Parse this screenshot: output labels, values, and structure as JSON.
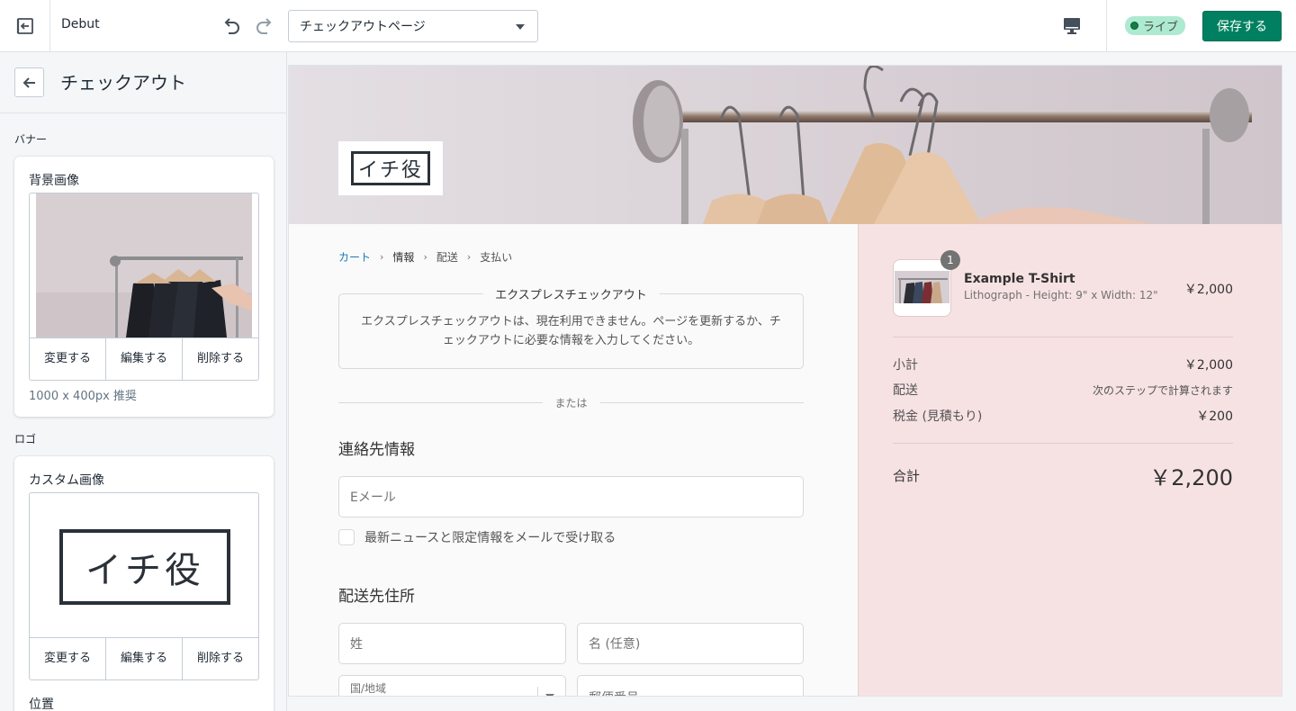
{
  "topbar": {
    "theme_name": "Debut",
    "page_select": "チェックアウトページ",
    "live_badge": "ライブ",
    "save_label": "保存する"
  },
  "sidebar": {
    "title": "チェックアウト",
    "banner_section": "バナー",
    "banner_card": {
      "label": "背景画像",
      "actions": [
        "変更する",
        "編集する",
        "削除する"
      ],
      "hint": "1000 x 400px 推奨"
    },
    "logo_section": "ロゴ",
    "logo_card": {
      "label": "カスタム画像",
      "logo_text": "イチ役",
      "actions": [
        "変更する",
        "編集する",
        "削除する"
      ],
      "position_label": "位置"
    }
  },
  "checkout": {
    "logo_text": "イチ役",
    "breadcrumbs": [
      "カート",
      "情報",
      "配送",
      "支払い"
    ],
    "express_title": "エクスプレスチェックアウト",
    "express_message": "エクスプレスチェックアウトは、現在利用できません。ページを更新するか、チェックアウトに必要な情報を入力してください。",
    "or_text": "または",
    "contact_heading": "連絡先情報",
    "email_placeholder": "Eメール",
    "newsletter_label": "最新ニュースと限定情報をメールで受け取る",
    "shipping_heading": "配送先住所",
    "last_name_placeholder": "姓",
    "first_name_placeholder": "名 (任意)",
    "country_label": "国/地域",
    "postal_placeholder": "郵便番号"
  },
  "summary": {
    "item": {
      "quantity": "1",
      "name": "Example T-Shirt",
      "variant": "Lithograph - Height: 9\" x Width: 12\"",
      "price": "￥2,000"
    },
    "subtotal_label": "小計",
    "subtotal_value": "￥2,000",
    "shipping_label": "配送",
    "shipping_value": "次のステップで計算されます",
    "tax_label": "税金 (見積もり)",
    "tax_value": "￥200",
    "total_label": "合計",
    "total_value": "￥2,200"
  },
  "colors": {
    "primary_button": "#008060",
    "live_badge_bg": "#aee9d1",
    "summary_bg": "#f7e2e3",
    "link": "#1878b9"
  }
}
